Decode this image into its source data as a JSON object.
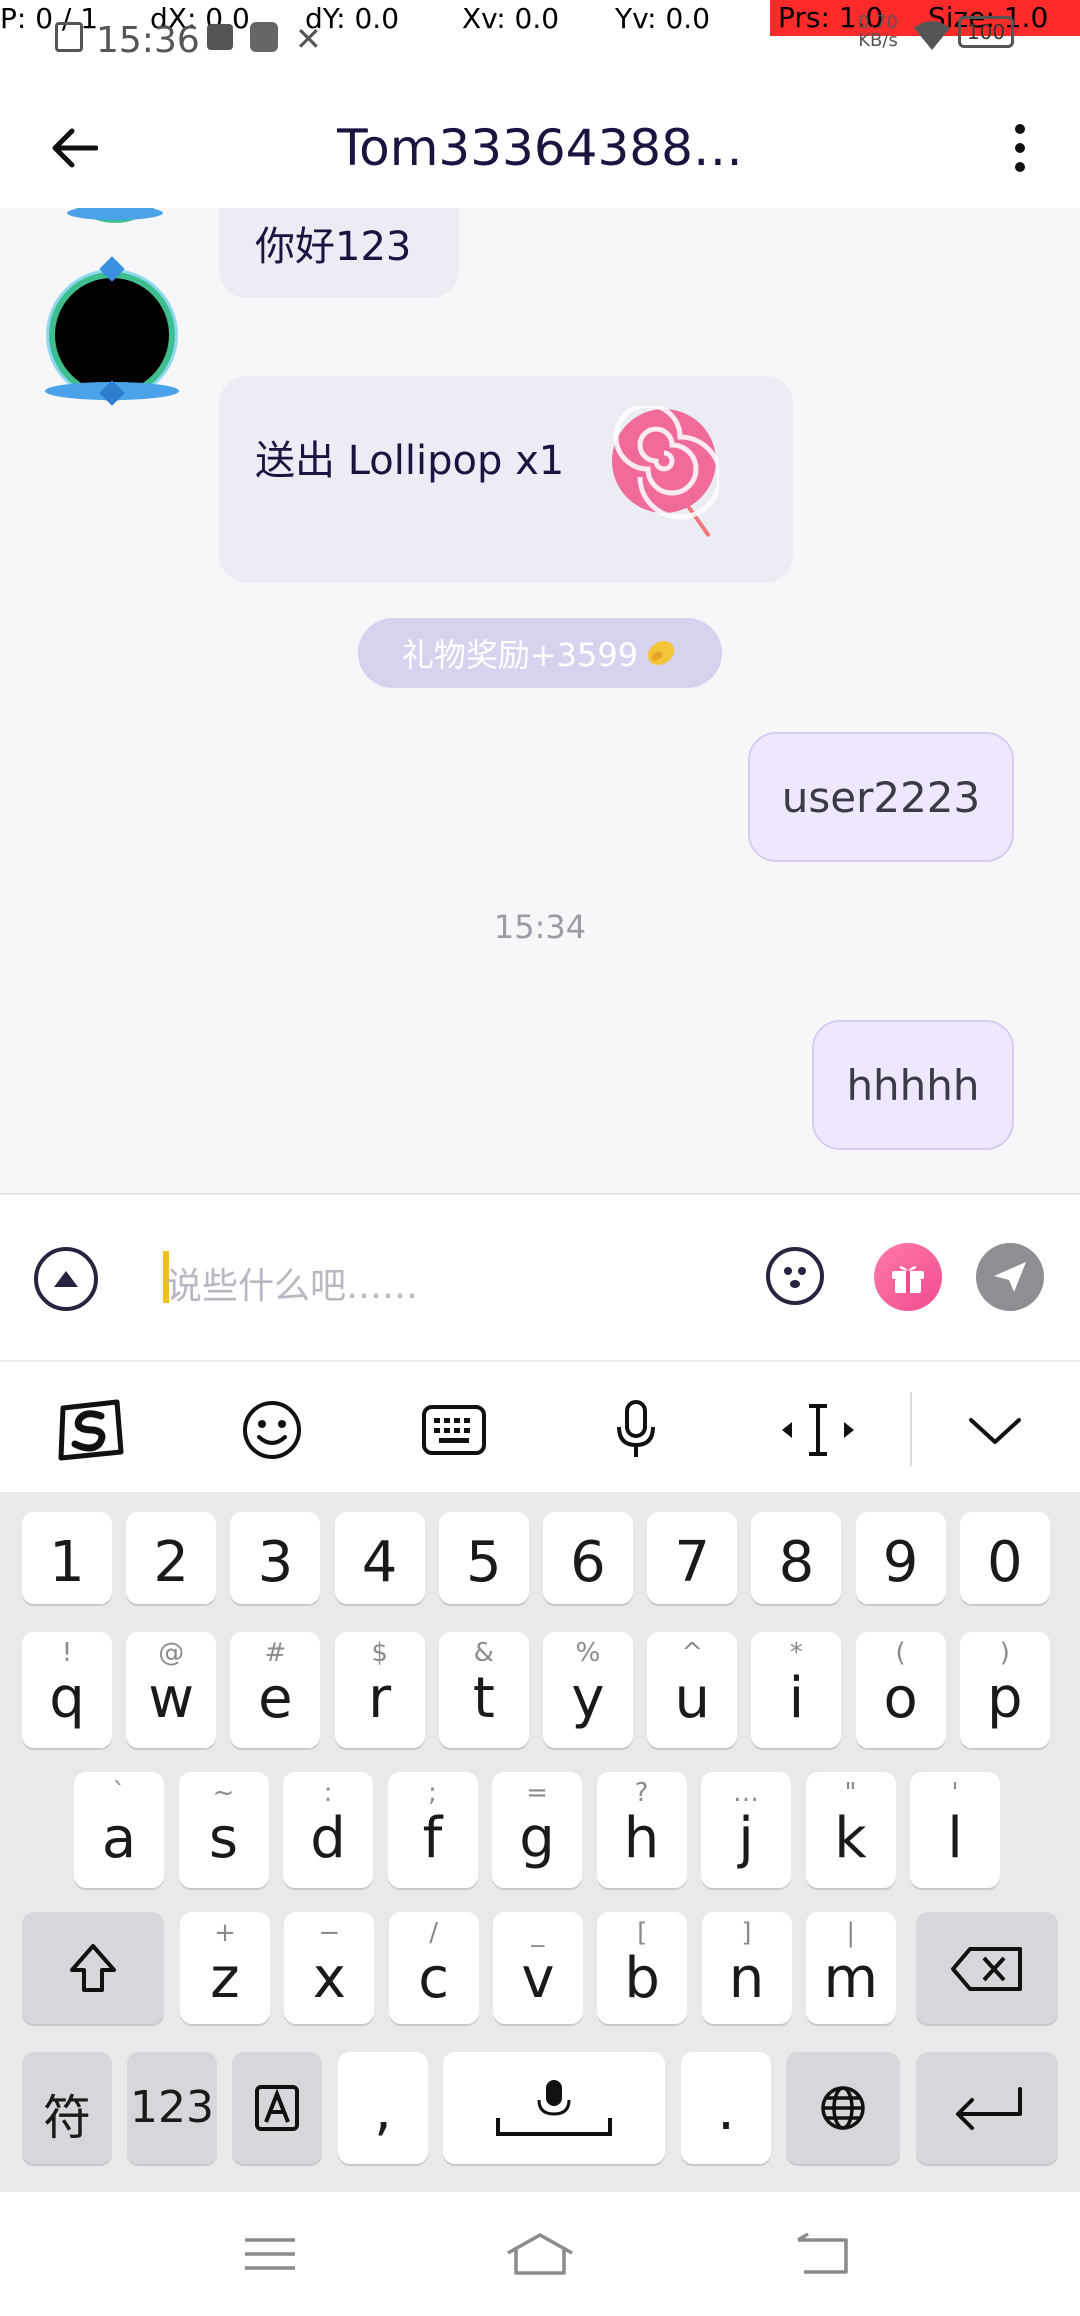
{
  "debug": {
    "p": "P: 0 / 1",
    "dx": "dX: 0.0",
    "dy": "dY: 0.0",
    "xv": "Xv: 0.0",
    "yv": "Yv: 0.0",
    "prs": "Prs: 1.0",
    "size": "Size: 1.0"
  },
  "status": {
    "time": "15:36",
    "net_speed_value": "0.70",
    "net_speed_unit": "KB/s",
    "battery": "100"
  },
  "header": {
    "title": "Tom33364388…"
  },
  "messages": {
    "partial_text": "你好123",
    "gift_text": "送出 Lollipop x1",
    "gift_reward": "礼物奖励+3599",
    "out1": "user2223",
    "time_divider": "15:34",
    "out2": "hhhhh"
  },
  "input": {
    "placeholder": "说些什么吧……"
  },
  "keyboard": {
    "numbers": [
      "1",
      "2",
      "3",
      "4",
      "5",
      "6",
      "7",
      "8",
      "9",
      "0"
    ],
    "row1": [
      {
        "k": "q",
        "s": "!"
      },
      {
        "k": "w",
        "s": "@"
      },
      {
        "k": "e",
        "s": "#"
      },
      {
        "k": "r",
        "s": "$"
      },
      {
        "k": "t",
        "s": "&"
      },
      {
        "k": "y",
        "s": "%"
      },
      {
        "k": "u",
        "s": "^"
      },
      {
        "k": "i",
        "s": "*"
      },
      {
        "k": "o",
        "s": "("
      },
      {
        "k": "p",
        "s": ")"
      }
    ],
    "row2": [
      {
        "k": "a",
        "s": "`"
      },
      {
        "k": "s",
        "s": "~"
      },
      {
        "k": "d",
        "s": ":"
      },
      {
        "k": "f",
        "s": ";"
      },
      {
        "k": "g",
        "s": "="
      },
      {
        "k": "h",
        "s": "?"
      },
      {
        "k": "j",
        "s": "…"
      },
      {
        "k": "k",
        "s": "\""
      },
      {
        "k": "l",
        "s": "'"
      }
    ],
    "row3": [
      {
        "k": "z",
        "s": "+"
      },
      {
        "k": "x",
        "s": "−"
      },
      {
        "k": "c",
        "s": "/"
      },
      {
        "k": "v",
        "s": "_"
      },
      {
        "k": "b",
        "s": "["
      },
      {
        "k": "n",
        "s": "]"
      },
      {
        "k": "m",
        "s": "|"
      }
    ],
    "symbols_key": "符",
    "num_key": "123",
    "comma_key": ",",
    "period_key": "."
  }
}
